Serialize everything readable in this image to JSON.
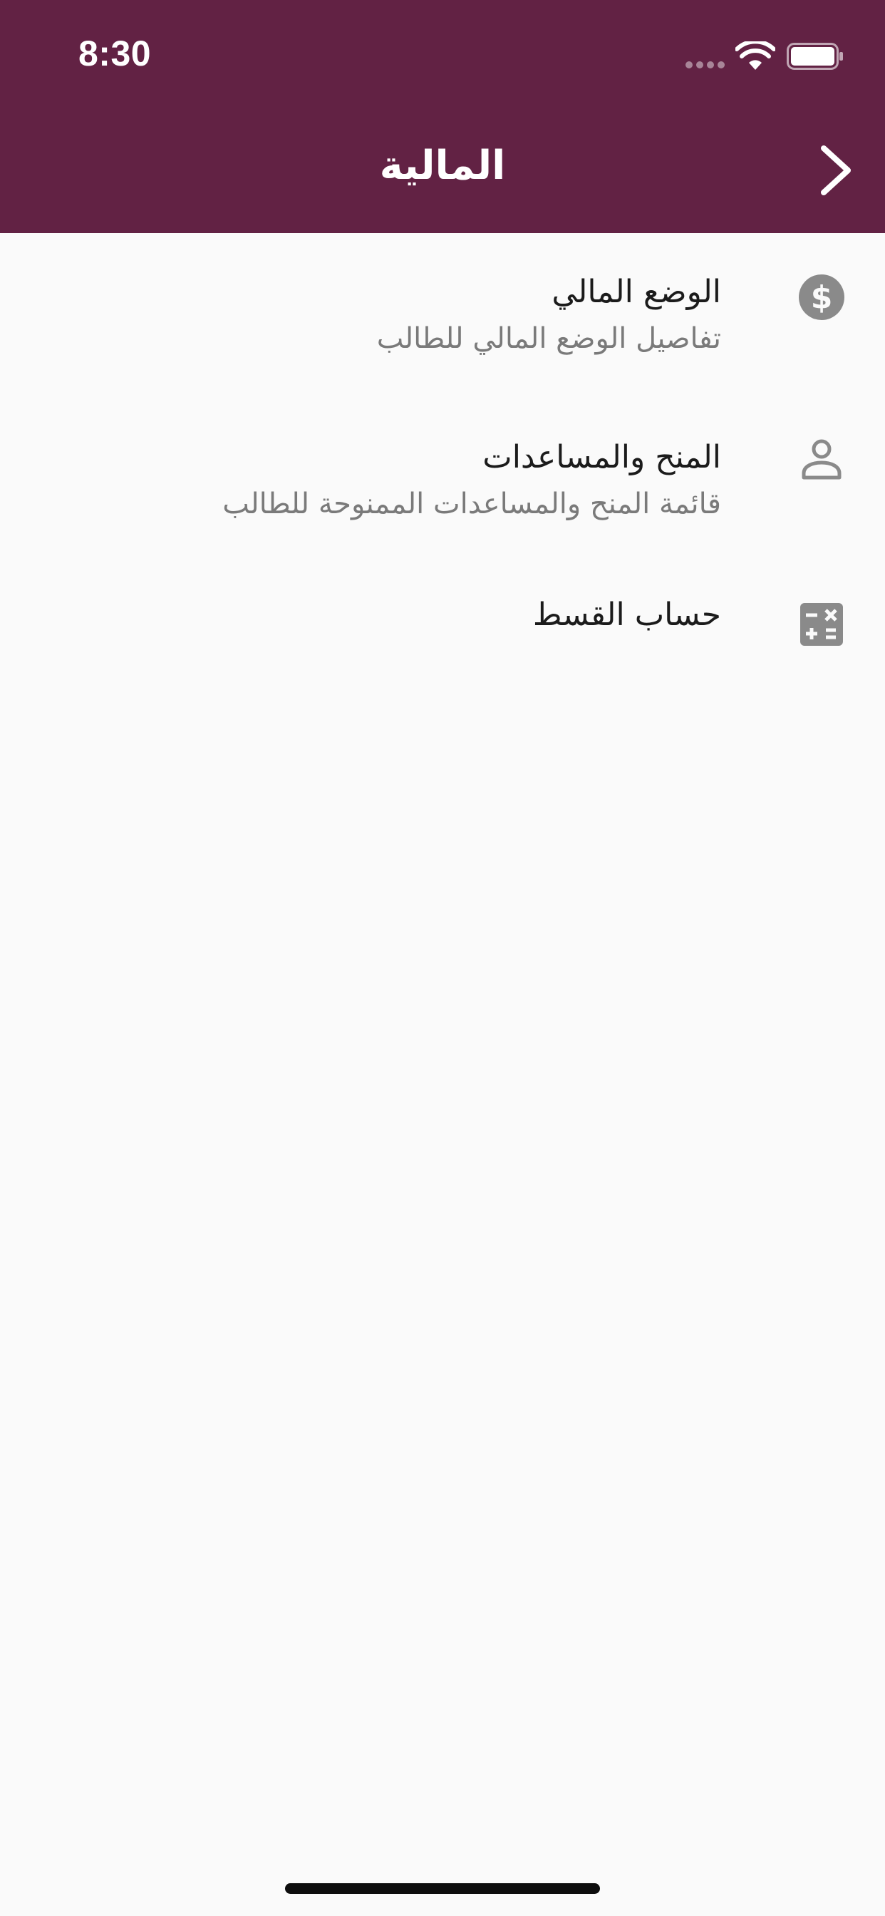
{
  "status_bar": {
    "time": "8:30"
  },
  "header": {
    "title": "المالية",
    "back_icon": "chevron-right-icon",
    "background_color": "#622244"
  },
  "menu": {
    "items": [
      {
        "title": "الوضع المالي",
        "subtitle": "تفاصيل الوضع المالي للطالب",
        "icon": "dollar-circle-icon"
      },
      {
        "title": "المنح والمساعدات",
        "subtitle": "قائمة المنح والمساعدات الممنوحة للطالب",
        "icon": "person-icon"
      },
      {
        "title": "حساب القسط",
        "subtitle": "",
        "icon": "calculator-icon"
      }
    ]
  },
  "colors": {
    "icon_gray": "#8a8a8a",
    "title_text": "#1b1b1b",
    "subtitle_text": "#7a7a7a",
    "background": "#fafafa"
  }
}
